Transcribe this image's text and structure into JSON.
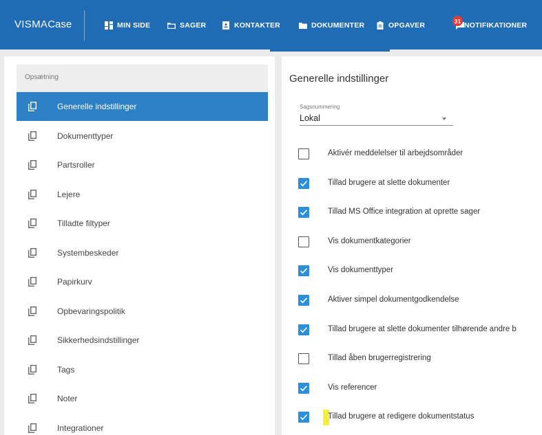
{
  "brand": {
    "part1": "VISMA",
    "part2": "Case"
  },
  "nav": {
    "items": [
      {
        "label": "MIN SIDE",
        "icon": "dashboard-icon"
      },
      {
        "label": "SAGER",
        "icon": "folder-icon"
      },
      {
        "label": "KONTAKTER",
        "icon": "contact-card-icon"
      },
      {
        "label": "DOKUMENTER",
        "icon": "documents-folder-icon"
      },
      {
        "label": "OPGAVER",
        "icon": "clipboard-icon"
      },
      {
        "label": "NOTIFIKATIONER",
        "icon": "chat-bell-icon",
        "badge": "31"
      }
    ]
  },
  "sidebar": {
    "header": "Opsætning",
    "items": [
      {
        "label": "Generelle indstillinger",
        "active": true
      },
      {
        "label": "Dokumenttyper"
      },
      {
        "label": "Partsroller"
      },
      {
        "label": "Lejere"
      },
      {
        "label": "Tilladte filtyper"
      },
      {
        "label": "Systembeskeder"
      },
      {
        "label": "Papirkurv"
      },
      {
        "label": "Opbevaringspolitik"
      },
      {
        "label": "Sikkerhedsindstillinger"
      },
      {
        "label": "Tags"
      },
      {
        "label": "Noter"
      },
      {
        "label": "Integrationer"
      }
    ]
  },
  "settings": {
    "title": "Generelle indstillinger",
    "numbering_label": "Sagsnummering",
    "numbering_value": "Lokal",
    "options": [
      {
        "label": "Aktivér meddelelser til arbejdsområder",
        "checked": false
      },
      {
        "label": "Tillad brugere at slette dokumenter",
        "checked": true
      },
      {
        "label": "Tillad MS Office integration at oprette sager",
        "checked": true
      },
      {
        "label": "Vis dokumentkategorier",
        "checked": false
      },
      {
        "label": "Vis dokumenttyper",
        "checked": true
      },
      {
        "label": "Aktiver simpel dokumentgodkendelse",
        "checked": true
      },
      {
        "label": "Tillad brugere at slette dokumenter tilhørende andre b",
        "checked": true
      },
      {
        "label": "Tillad åben brugerregistrering",
        "checked": false
      },
      {
        "label": "Vis referencer",
        "checked": true
      },
      {
        "label": "Tillad brugere at redigere dokumentstatus",
        "checked": true
      }
    ]
  },
  "colors": {
    "topbar": "#1f6cb5",
    "active": "#2d7fc6",
    "checkbox": "#2d8fd9",
    "highlight": "#f7f03a",
    "badge": "#e53935"
  }
}
